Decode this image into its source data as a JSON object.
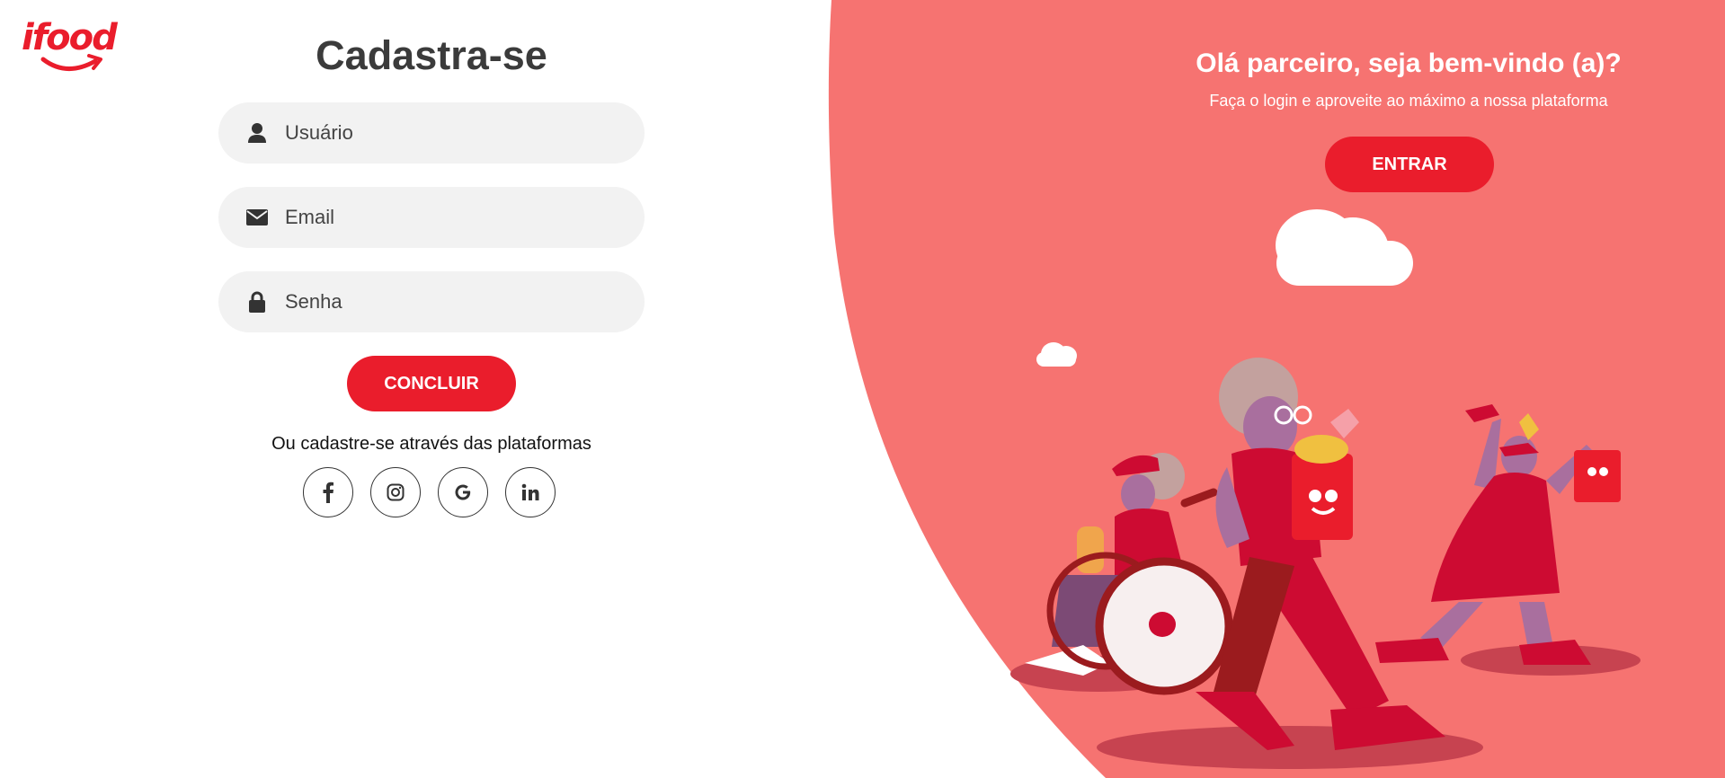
{
  "brand": {
    "logo_text": "ifood",
    "color": "#ea1d2c"
  },
  "signup": {
    "title": "Cadastra-se",
    "fields": [
      {
        "icon": "user-icon",
        "placeholder": "Usuário"
      },
      {
        "icon": "envelope-icon",
        "placeholder": "Email"
      },
      {
        "icon": "lock-icon",
        "placeholder": "Senha"
      }
    ],
    "submit_label": "CONCLUIR",
    "alt_text": "Ou cadastre-se através das plataformas",
    "socials": [
      "facebook-icon",
      "instagram-icon",
      "google-icon",
      "linkedin-icon"
    ]
  },
  "welcome": {
    "title": "Olá parceiro, seja bem-vindo (a)?",
    "subtitle": "Faça o login e aproveite ao máximo a nossa plataforma",
    "login_label": "ENTRAR",
    "panel_color": "#f67371"
  }
}
